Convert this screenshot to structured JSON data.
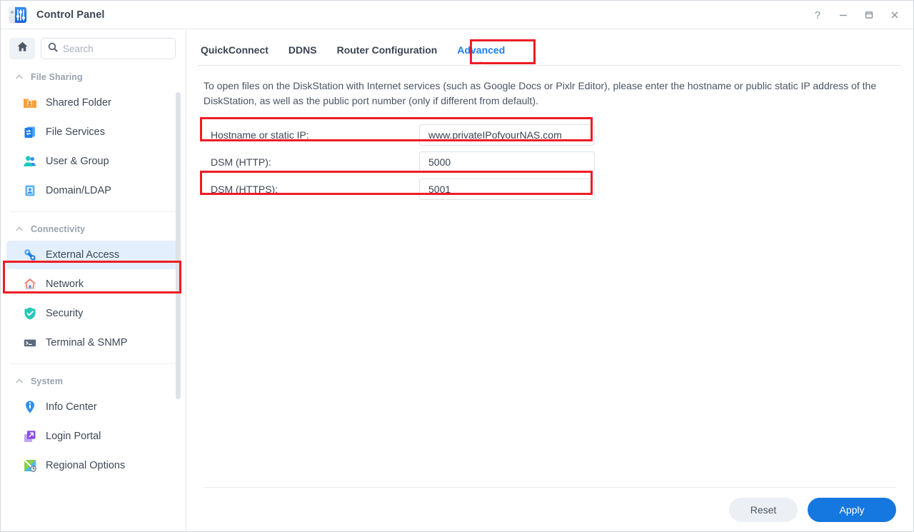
{
  "window": {
    "title": "Control Panel",
    "app_icon": "control-panel-icon",
    "controls": [
      {
        "name": "help-button",
        "glyph": "?"
      },
      {
        "name": "minimize-button",
        "glyph": "minimize-icon"
      },
      {
        "name": "maximize-button",
        "glyph": "maximize-icon"
      },
      {
        "name": "close-button",
        "glyph": "close-icon"
      }
    ]
  },
  "sidebar": {
    "home_button": "home-icon",
    "search": {
      "placeholder": "Search",
      "value": ""
    },
    "groups": [
      {
        "label": "File Sharing",
        "items": [
          {
            "label": "Shared Folder",
            "icon": "shared-folder-icon"
          },
          {
            "label": "File Services",
            "icon": "file-services-icon"
          },
          {
            "label": "User & Group",
            "icon": "user-group-icon"
          },
          {
            "label": "Domain/LDAP",
            "icon": "domain-ldap-icon"
          }
        ]
      },
      {
        "label": "Connectivity",
        "items": [
          {
            "label": "External Access",
            "icon": "external-access-icon",
            "active": true,
            "highlighted": true
          },
          {
            "label": "Network",
            "icon": "network-icon"
          },
          {
            "label": "Security",
            "icon": "security-icon"
          },
          {
            "label": "Terminal & SNMP",
            "icon": "terminal-snmp-icon"
          }
        ]
      },
      {
        "label": "System",
        "items": [
          {
            "label": "Info Center",
            "icon": "info-center-icon"
          },
          {
            "label": "Login Portal",
            "icon": "login-portal-icon"
          },
          {
            "label": "Regional Options",
            "icon": "regional-options-icon"
          }
        ]
      }
    ]
  },
  "main": {
    "tabs": [
      {
        "label": "QuickConnect",
        "active": false
      },
      {
        "label": "DDNS",
        "active": false
      },
      {
        "label": "Router Configuration",
        "active": false
      },
      {
        "label": "Advanced",
        "active": true,
        "highlighted": true
      }
    ],
    "description": "To open files on the DiskStation with Internet services (such as Google Docs or Pixlr Editor), please enter the hostname or public static IP address of the DiskStation, as well as the public port number (only if different from default).",
    "fields": [
      {
        "label": "Hostname or static IP:",
        "value": "www.privateIPofyourNAS.com",
        "highlighted": true
      },
      {
        "label": "DSM (HTTP):",
        "value": "5000",
        "highlighted": false
      },
      {
        "label": "DSM (HTTPS):",
        "value": "5001",
        "highlighted": true
      }
    ],
    "footer": {
      "reset_label": "Reset",
      "apply_label": "Apply"
    }
  },
  "colors": {
    "accent": "#1577e0",
    "tab_active": "#1a7cf0",
    "annotation": "#ee1c25",
    "sidebar_active_bg": "#e3effc"
  }
}
